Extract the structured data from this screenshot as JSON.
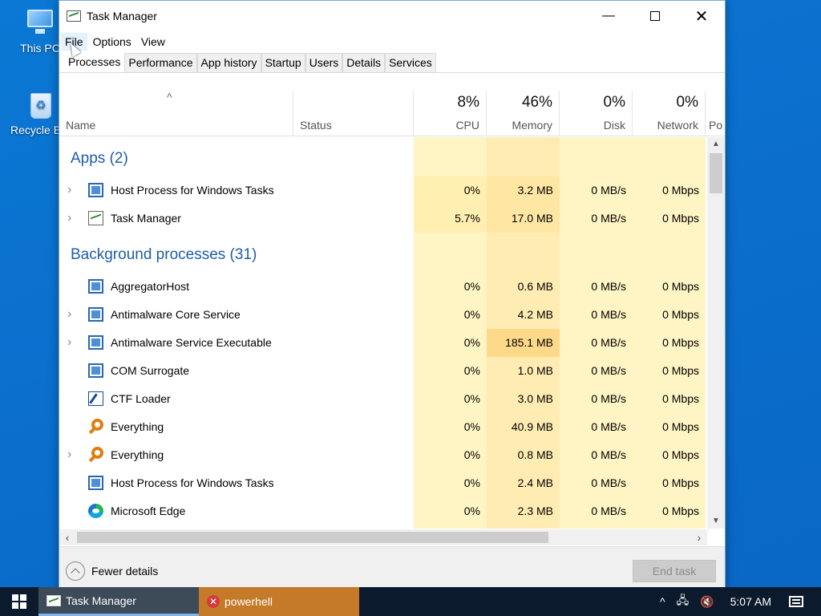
{
  "desktop": {
    "icons": [
      {
        "label": "This PC"
      },
      {
        "label": "Recycle Bin"
      }
    ]
  },
  "window": {
    "title": "Task Manager",
    "controls": {
      "minimize": "—",
      "close": "✕"
    },
    "menu": [
      "File",
      "Options",
      "View"
    ],
    "tabs": [
      "Processes",
      "Performance",
      "App history",
      "Startup",
      "Users",
      "Details",
      "Services"
    ],
    "active_tab": "Processes"
  },
  "columns": {
    "name": "Name",
    "status": "Status",
    "cpu": {
      "pct": "8%",
      "label": "CPU"
    },
    "memory": {
      "pct": "46%",
      "label": "Memory"
    },
    "disk": {
      "pct": "0%",
      "label": "Disk"
    },
    "network": {
      "pct": "0%",
      "label": "Network"
    },
    "power": "Po",
    "sort_caret": "^"
  },
  "groups": {
    "apps": "Apps (2)",
    "background": "Background processes (31)"
  },
  "apps": [
    {
      "name": "Host Process for Windows Tasks",
      "cpu": "0%",
      "memory": "3.2 MB",
      "disk": "0 MB/s",
      "network": "0 Mbps",
      "expandable": true,
      "icon": "host-process-icon"
    },
    {
      "name": "Task Manager",
      "cpu": "5.7%",
      "memory": "17.0 MB",
      "disk": "0 MB/s",
      "network": "0 Mbps",
      "expandable": true,
      "icon": "task-manager-icon"
    }
  ],
  "background": [
    {
      "name": "AggregatorHost",
      "cpu": "0%",
      "memory": "0.6 MB",
      "disk": "0 MB/s",
      "network": "0 Mbps",
      "expandable": false,
      "icon": "host-process-icon"
    },
    {
      "name": "Antimalware Core Service",
      "cpu": "0%",
      "memory": "4.2 MB",
      "disk": "0 MB/s",
      "network": "0 Mbps",
      "expandable": true,
      "icon": "host-process-icon"
    },
    {
      "name": "Antimalware Service Executable",
      "cpu": "0%",
      "memory": "185.1 MB",
      "disk": "0 MB/s",
      "network": "0 Mbps",
      "expandable": true,
      "icon": "host-process-icon"
    },
    {
      "name": "COM Surrogate",
      "cpu": "0%",
      "memory": "1.0 MB",
      "disk": "0 MB/s",
      "network": "0 Mbps",
      "expandable": false,
      "icon": "host-process-icon"
    },
    {
      "name": "CTF Loader",
      "cpu": "0%",
      "memory": "3.0 MB",
      "disk": "0 MB/s",
      "network": "0 Mbps",
      "expandable": false,
      "icon": "ctf-loader-icon"
    },
    {
      "name": "Everything",
      "cpu": "0%",
      "memory": "40.9 MB",
      "disk": "0 MB/s",
      "network": "0 Mbps",
      "expandable": false,
      "icon": "everything-search-icon"
    },
    {
      "name": "Everything",
      "cpu": "0%",
      "memory": "0.8 MB",
      "disk": "0 MB/s",
      "network": "0 Mbps",
      "expandable": true,
      "icon": "everything-search-icon"
    },
    {
      "name": "Host Process for Windows Tasks",
      "cpu": "0%",
      "memory": "2.4 MB",
      "disk": "0 MB/s",
      "network": "0 Mbps",
      "expandable": false,
      "icon": "host-process-icon"
    },
    {
      "name": "Microsoft Edge",
      "cpu": "0%",
      "memory": "2.3 MB",
      "disk": "0 MB/s",
      "network": "0 Mbps",
      "expandable": false,
      "icon": "edge-icon"
    }
  ],
  "footer": {
    "fewer_details": "Fewer details",
    "end_task": "End task"
  },
  "taskbar": {
    "apps": [
      {
        "label": "Task Manager",
        "active": true
      },
      {
        "label": "powerhell",
        "active": false
      }
    ],
    "clock": "5:07 AM",
    "tray_caret": "^"
  },
  "colors": {
    "cpu_bg": "#fff4c4",
    "memory_bg": "#ffecb3",
    "memory_hot": "#ffd98a",
    "group_title": "#1f5da8",
    "taskbar": "#0b1a2c",
    "accent": "#0a78d4"
  }
}
